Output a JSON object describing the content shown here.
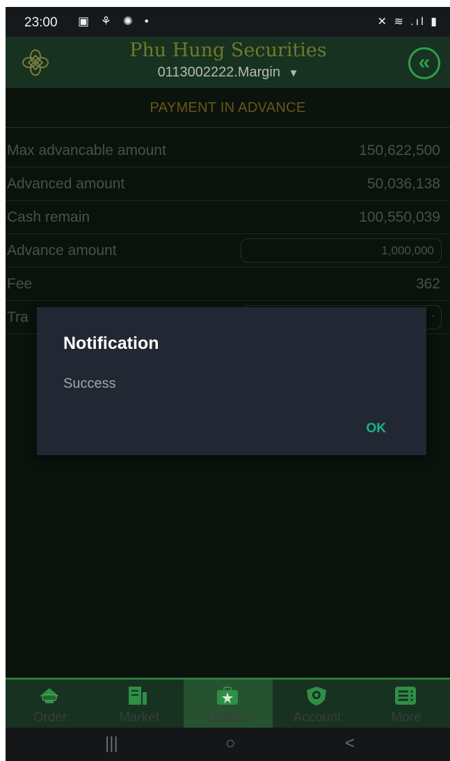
{
  "status_bar": {
    "time": "23:00",
    "left_icons": "▣ ⚘ ✺ •",
    "right_icons": "✕ ≋ .ıl ▮"
  },
  "header": {
    "brand": "Phu Hung Securities",
    "account": "0113002222.Margin",
    "caret": "▼",
    "back_icon": "«"
  },
  "page": {
    "title": "PAYMENT IN ADVANCE"
  },
  "rows": [
    {
      "label": "Max advancable amount",
      "value": "150,622,500"
    },
    {
      "label": "Advanced amount",
      "value": "50,036,138"
    },
    {
      "label": "Cash remain",
      "value": "100,550,039"
    },
    {
      "label": "Advance amount",
      "value": "1,000,000"
    },
    {
      "label": "Fee",
      "value": "362"
    },
    {
      "label": "Tra",
      "value": ""
    }
  ],
  "dialog": {
    "title": "Notification",
    "message": "Success",
    "ok_label": "OK"
  },
  "nav": [
    {
      "label": "Order",
      "icon": "order-icon"
    },
    {
      "label": "Market",
      "icon": "market-icon"
    },
    {
      "label": "Utilities",
      "icon": "star-briefcase-icon",
      "active": true
    },
    {
      "label": "Account",
      "icon": "shield-icon"
    },
    {
      "label": "More",
      "icon": "menu-icon"
    }
  ],
  "system_nav": {
    "recents": "|||",
    "home": "○",
    "back": "<"
  },
  "colors": {
    "background": "#0a120c",
    "header": "#173221",
    "accent_green": "#2f9f45",
    "title_gold": "#6b5617",
    "dialog_bg": "#222833",
    "ok_color": "#19b28a"
  }
}
